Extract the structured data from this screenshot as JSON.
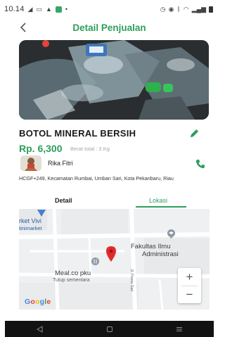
{
  "status_bar": {
    "time": "10.14",
    "left_icons": [
      "navigation-icon",
      "message-icon",
      "warning-icon",
      "app-icon",
      "dot-icon"
    ],
    "right_icons": [
      "alarm-icon",
      "focus-icon",
      "bluetooth-icon",
      "wifi-icon",
      "signal-icon",
      "battery-icon"
    ]
  },
  "header": {
    "title": "Detail Penjualan",
    "back_icon": "chevron-left-icon"
  },
  "product": {
    "name": "BOTOL MINERAL BERSIH",
    "price": "Rp. 6,300",
    "weight": "Berat total : 3 Kg",
    "edit_icon": "pencil-icon"
  },
  "seller": {
    "name": "Rika Fitri",
    "call_icon": "phone-icon"
  },
  "address": "HCGF+249, Kecamatan Rumbai, Umban Sari, Kota Pekanbaru, Riau",
  "tabs": [
    {
      "label": "Detail",
      "active": false
    },
    {
      "label": "Lokasi",
      "active": true
    }
  ],
  "map": {
    "labels": {
      "market_line1": "rket Vivi",
      "market_line2": "tinimarket",
      "fakultas_line1": "Fakultas Ilmu",
      "fakultas_line2": "Administrasi",
      "meal": "Meal.co pku",
      "meal_status": "Tutup sementara",
      "street": "Jl. Pesta Sari",
      "google": "Google"
    },
    "zoom_in": "+",
    "zoom_out": "−",
    "marker_color": "#e02b2b"
  },
  "colors": {
    "accent": "#2e9e5b"
  },
  "nav_bar": [
    "back-triangle-icon",
    "home-square-icon",
    "recents-lines-icon"
  ]
}
